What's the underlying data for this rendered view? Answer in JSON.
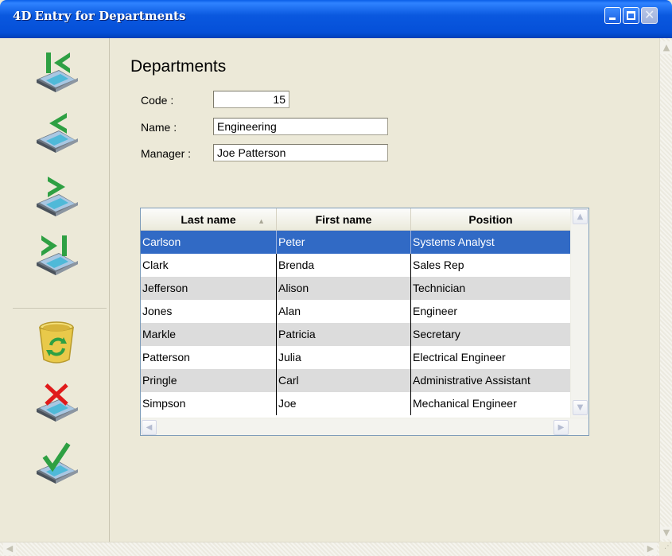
{
  "window": {
    "logo": "4D",
    "title": "Entry for Departments"
  },
  "toolbar": {
    "buttons": [
      {
        "name": "first-record",
        "icon": "first-record-icon"
      },
      {
        "name": "previous-record",
        "icon": "previous-record-icon"
      },
      {
        "name": "next-record",
        "icon": "next-record-icon"
      },
      {
        "name": "last-record",
        "icon": "last-record-icon"
      },
      {
        "name": "delete-record",
        "icon": "trash-recycle-icon"
      },
      {
        "name": "cancel",
        "icon": "cancel-x-icon"
      },
      {
        "name": "accept",
        "icon": "accept-check-icon"
      }
    ]
  },
  "form": {
    "title": "Departments",
    "code_label": "Code :",
    "code_value": "15",
    "name_label": "Name :",
    "name_value": "Engineering",
    "manager_label": "Manager :",
    "manager_value": "Joe Patterson"
  },
  "grid": {
    "headers": [
      "Last name",
      "First name",
      "Position"
    ],
    "rows": [
      {
        "last": "Carlson",
        "first": "Peter",
        "position": "Systems Analyst",
        "selected": true
      },
      {
        "last": "Clark",
        "first": "Brenda",
        "position": "Sales Rep"
      },
      {
        "last": "Jefferson",
        "first": "Alison",
        "position": "Technician"
      },
      {
        "last": "Jones",
        "first": "Alan",
        "position": "Engineer"
      },
      {
        "last": "Markle",
        "first": "Patricia",
        "position": "Secretary"
      },
      {
        "last": "Patterson",
        "first": "Julia",
        "position": "Electrical Engineer"
      },
      {
        "last": "Pringle",
        "first": "Carl",
        "position": "Administrative Assistant"
      },
      {
        "last": "Simpson",
        "first": "Joe",
        "position": "Mechanical Engineer"
      }
    ]
  },
  "colors": {
    "titlebar": "#0a58df",
    "selection": "#316ac5",
    "window_bg": "#ece9d8",
    "alt_row": "#dcdcdc"
  }
}
